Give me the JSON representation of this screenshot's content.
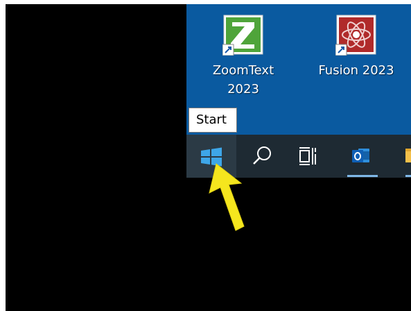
{
  "desktop": {
    "background_color": "#0a5aa0",
    "icons": [
      {
        "label": "ZoomText 2023",
        "label_line1": "ZoomText",
        "label_line2": "2023",
        "icon": "zoomtext-z-icon"
      },
      {
        "label": "Fusion 2023",
        "icon": "fusion-atom-icon"
      }
    ]
  },
  "tooltip": {
    "text": "Start"
  },
  "taskbar": {
    "background_color": "#1e2a33",
    "items": [
      {
        "name": "start",
        "icon": "windows-logo-icon"
      },
      {
        "name": "search",
        "icon": "search-icon"
      },
      {
        "name": "task-view",
        "icon": "task-view-icon"
      },
      {
        "name": "outlook",
        "icon": "outlook-icon",
        "active": true
      },
      {
        "name": "file-explorer",
        "icon": "folder-icon",
        "active": true
      }
    ]
  },
  "annotation": {
    "icon": "yellow-pointer-arrow",
    "color": "#f5e61e",
    "target": "start"
  }
}
